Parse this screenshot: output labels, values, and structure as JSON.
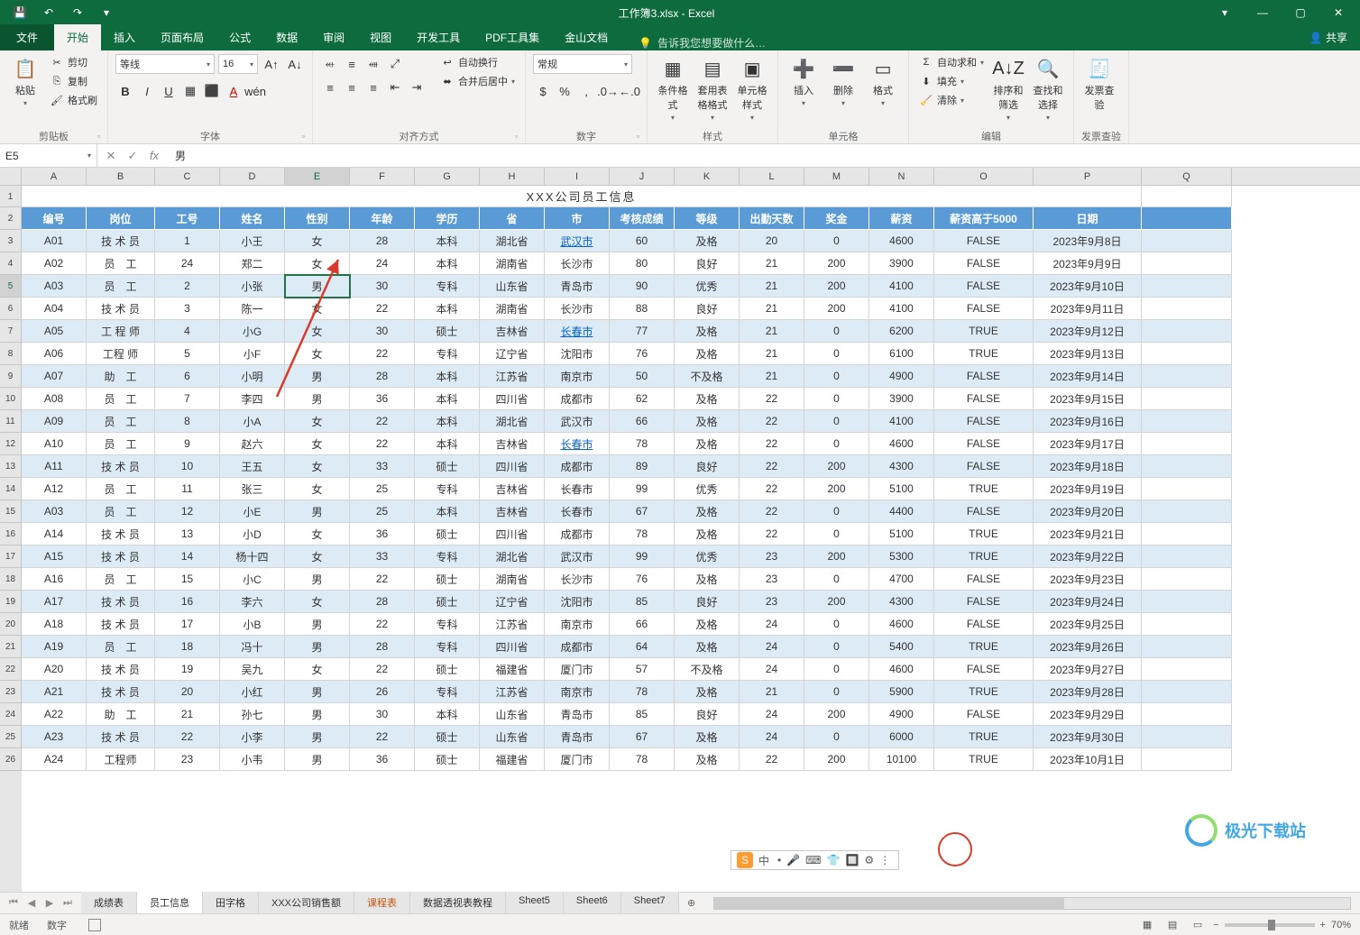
{
  "titlebar": {
    "title": "工作簿3.xlsx - Excel"
  },
  "window_buttons": {
    "minimize": "—",
    "maximize": "▢",
    "close": "✕",
    "ribbon_opts": "▾"
  },
  "ribbon_tabs": {
    "file": "文件",
    "home": "开始",
    "insert": "插入",
    "layout": "页面布局",
    "formulas": "公式",
    "data": "数据",
    "review": "审阅",
    "view": "视图",
    "dev": "开发工具",
    "pdf": "PDF工具集",
    "wps": "金山文档",
    "tell_me": "告诉我您想要做什么…",
    "share": "共享"
  },
  "ribbon": {
    "clipboard": {
      "paste": "粘贴",
      "cut": "剪切",
      "copy": "复制",
      "format_painter": "格式刷",
      "label": "剪贴板"
    },
    "font": {
      "name": "等线",
      "size": "16",
      "label": "字体"
    },
    "alignment": {
      "wrap": "自动换行",
      "merge": "合并后居中",
      "label": "对齐方式"
    },
    "number": {
      "format": "常规",
      "label": "数字"
    },
    "styles": {
      "cond": "条件格式",
      "table": "套用表格格式",
      "cell": "单元格样式",
      "label": "样式"
    },
    "cells": {
      "insert": "插入",
      "delete": "删除",
      "format": "格式",
      "label": "单元格"
    },
    "editing": {
      "autosum": "自动求和",
      "fill": "填充",
      "clear": "清除",
      "sort": "排序和筛选",
      "find": "查找和选择",
      "label": "编辑"
    },
    "invoice": {
      "btn": "发票查验",
      "label": "发票查验"
    }
  },
  "namebox": "E5",
  "formula_value": "男",
  "columns": [
    "A",
    "B",
    "C",
    "D",
    "E",
    "F",
    "G",
    "H",
    "I",
    "J",
    "K",
    "L",
    "M",
    "N",
    "O",
    "P",
    "Q"
  ],
  "table_title": "XXX公司员工信息",
  "headers": [
    "编号",
    "岗位",
    "工号",
    "姓名",
    "性别",
    "年龄",
    "学历",
    "省",
    "市",
    "考核成绩",
    "等级",
    "出勤天数",
    "奖金",
    "薪资",
    "薪资高于5000",
    "日期"
  ],
  "rows": [
    [
      "A01",
      "技 术 员",
      "1",
      "小王",
      "女",
      "28",
      "本科",
      "湖北省",
      "武汉市",
      "60",
      "及格",
      "20",
      "0",
      "4600",
      "FALSE",
      "2023年9月8日"
    ],
    [
      "A02",
      "员　工",
      "24",
      "郑二",
      "女",
      "24",
      "本科",
      "湖南省",
      "长沙市",
      "80",
      "良好",
      "21",
      "200",
      "3900",
      "FALSE",
      "2023年9月9日"
    ],
    [
      "A03",
      "员　工",
      "2",
      "小张",
      "男",
      "30",
      "专科",
      "山东省",
      "青岛市",
      "90",
      "优秀",
      "21",
      "200",
      "4100",
      "FALSE",
      "2023年9月10日"
    ],
    [
      "A04",
      "技 术 员",
      "3",
      "陈一",
      "女",
      "22",
      "本科",
      "湖南省",
      "长沙市",
      "88",
      "良好",
      "21",
      "200",
      "4100",
      "FALSE",
      "2023年9月11日"
    ],
    [
      "A05",
      "工 程 师",
      "4",
      "小G",
      "女",
      "30",
      "硕士",
      "吉林省",
      "长春市",
      "77",
      "及格",
      "21",
      "0",
      "6200",
      "TRUE",
      "2023年9月12日"
    ],
    [
      "A06",
      "工程 师",
      "5",
      "小F",
      "女",
      "22",
      "专科",
      "辽宁省",
      "沈阳市",
      "76",
      "及格",
      "21",
      "0",
      "6100",
      "TRUE",
      "2023年9月13日"
    ],
    [
      "A07",
      "助　工",
      "6",
      "小明",
      "男",
      "28",
      "本科",
      "江苏省",
      "南京市",
      "50",
      "不及格",
      "21",
      "0",
      "4900",
      "FALSE",
      "2023年9月14日"
    ],
    [
      "A08",
      "员　工",
      "7",
      "李四",
      "男",
      "36",
      "本科",
      "四川省",
      "成都市",
      "62",
      "及格",
      "22",
      "0",
      "3900",
      "FALSE",
      "2023年9月15日"
    ],
    [
      "A09",
      "员　工",
      "8",
      "小A",
      "女",
      "22",
      "本科",
      "湖北省",
      "武汉市",
      "66",
      "及格",
      "22",
      "0",
      "4100",
      "FALSE",
      "2023年9月16日"
    ],
    [
      "A10",
      "员　工",
      "9",
      "赵六",
      "女",
      "22",
      "本科",
      "吉林省",
      "长春市",
      "78",
      "及格",
      "22",
      "0",
      "4600",
      "FALSE",
      "2023年9月17日"
    ],
    [
      "A11",
      "技 术 员",
      "10",
      "王五",
      "女",
      "33",
      "硕士",
      "四川省",
      "成都市",
      "89",
      "良好",
      "22",
      "200",
      "4300",
      "FALSE",
      "2023年9月18日"
    ],
    [
      "A12",
      "员　工",
      "11",
      "张三",
      "女",
      "25",
      "专科",
      "吉林省",
      "长春市",
      "99",
      "优秀",
      "22",
      "200",
      "5100",
      "TRUE",
      "2023年9月19日"
    ],
    [
      "A03",
      "员　工",
      "12",
      "小E",
      "男",
      "25",
      "本科",
      "吉林省",
      "长春市",
      "67",
      "及格",
      "22",
      "0",
      "4400",
      "FALSE",
      "2023年9月20日"
    ],
    [
      "A14",
      "技 术 员",
      "13",
      "小D",
      "女",
      "36",
      "硕士",
      "四川省",
      "成都市",
      "78",
      "及格",
      "22",
      "0",
      "5100",
      "TRUE",
      "2023年9月21日"
    ],
    [
      "A15",
      "技 术 员",
      "14",
      "杨十四",
      "女",
      "33",
      "专科",
      "湖北省",
      "武汉市",
      "99",
      "优秀",
      "23",
      "200",
      "5300",
      "TRUE",
      "2023年9月22日"
    ],
    [
      "A16",
      "员　工",
      "15",
      "小C",
      "男",
      "22",
      "硕士",
      "湖南省",
      "长沙市",
      "76",
      "及格",
      "23",
      "0",
      "4700",
      "FALSE",
      "2023年9月23日"
    ],
    [
      "A17",
      "技 术 员",
      "16",
      "李六",
      "女",
      "28",
      "硕士",
      "辽宁省",
      "沈阳市",
      "85",
      "良好",
      "23",
      "200",
      "4300",
      "FALSE",
      "2023年9月24日"
    ],
    [
      "A18",
      "技 术 员",
      "17",
      "小B",
      "男",
      "22",
      "专科",
      "江苏省",
      "南京市",
      "66",
      "及格",
      "24",
      "0",
      "4600",
      "FALSE",
      "2023年9月25日"
    ],
    [
      "A19",
      "员　工",
      "18",
      "冯十",
      "男",
      "28",
      "专科",
      "四川省",
      "成都市",
      "64",
      "及格",
      "24",
      "0",
      "5400",
      "TRUE",
      "2023年9月26日"
    ],
    [
      "A20",
      "技 术 员",
      "19",
      "吴九",
      "女",
      "22",
      "硕士",
      "福建省",
      "厦门市",
      "57",
      "不及格",
      "24",
      "0",
      "4600",
      "FALSE",
      "2023年9月27日"
    ],
    [
      "A21",
      "技 术 员",
      "20",
      "小红",
      "男",
      "26",
      "专科",
      "江苏省",
      "南京市",
      "78",
      "及格",
      "21",
      "0",
      "5900",
      "TRUE",
      "2023年9月28日"
    ],
    [
      "A22",
      "助　工",
      "21",
      "孙七",
      "男",
      "30",
      "本科",
      "山东省",
      "青岛市",
      "85",
      "良好",
      "24",
      "200",
      "4900",
      "FALSE",
      "2023年9月29日"
    ],
    [
      "A23",
      "技 术 员",
      "22",
      "小李",
      "男",
      "22",
      "硕士",
      "山东省",
      "青岛市",
      "67",
      "及格",
      "24",
      "0",
      "6000",
      "TRUE",
      "2023年9月30日"
    ],
    [
      "A24",
      "工程师",
      "23",
      "小韦",
      "男",
      "36",
      "硕士",
      "福建省",
      "厦门市",
      "78",
      "及格",
      "22",
      "200",
      "10100",
      "TRUE",
      "2023年10月1日"
    ]
  ],
  "link_cells": [
    [
      0,
      8
    ],
    [
      4,
      8
    ],
    [
      9,
      8
    ]
  ],
  "selected": {
    "row": 2,
    "col": 4
  },
  "sheets": [
    "成绩表",
    "员工信息",
    "田字格",
    "XXX公司销售额",
    "课程表",
    "数据透视表教程",
    "Sheet5",
    "Sheet6",
    "Sheet7"
  ],
  "sheet_active": 1,
  "sheet_colored": [
    4
  ],
  "status": {
    "ready": "就绪",
    "count": "数字",
    "zoom": "70%"
  },
  "ime": {
    "logo": "S",
    "txt": "中",
    "items": [
      "•",
      "🎤",
      "⌨",
      "👕",
      "🔲",
      "⚙",
      "⋮"
    ]
  },
  "watermark": "极光下载站"
}
